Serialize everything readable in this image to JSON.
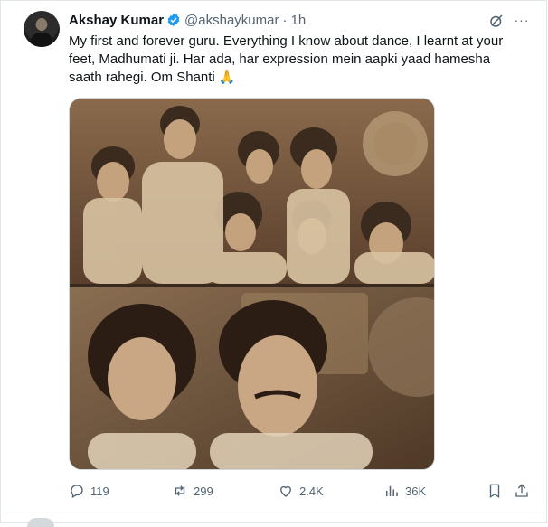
{
  "post": {
    "author_name": "Akshay Kumar",
    "handle": "@akshaykumar",
    "separator": "·",
    "time": "1h",
    "more_label": "···",
    "text": "My first and forever guru. Everything I know about dance, I learnt at your feet, Madhumati ji. Har ada, har expression mein aapki yaad hamesha saath rahegi. Om Shanti 🙏"
  },
  "icons": {
    "verified": "verified-badge-icon",
    "grok": "grok-icon",
    "more": "more-icon",
    "reply": "reply-icon",
    "repost": "repost-icon",
    "like": "like-icon",
    "views": "views-icon",
    "bookmark": "bookmark-icon",
    "share": "share-icon"
  },
  "actions": {
    "replies": "119",
    "reposts": "299",
    "likes": "2.4K",
    "views": "36K"
  },
  "colors": {
    "accent": "#1d9bf0",
    "muted": "#536471",
    "text": "#0f1419"
  }
}
